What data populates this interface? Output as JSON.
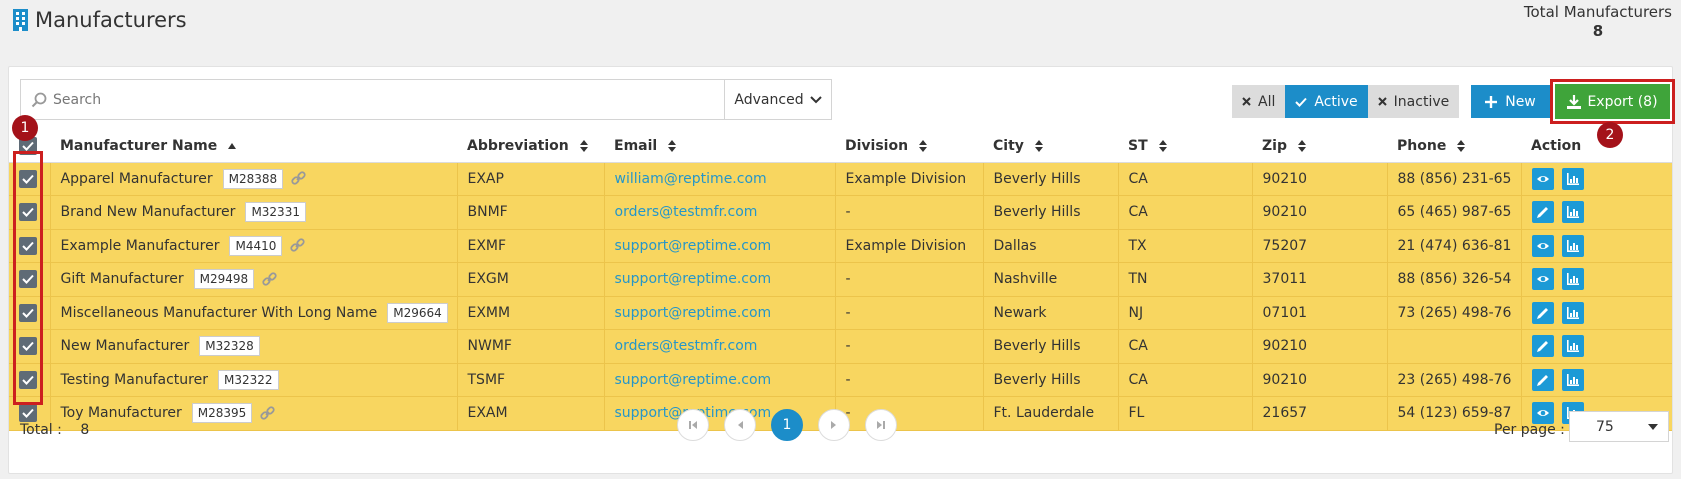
{
  "header": {
    "title": "Manufacturers",
    "total_label": "Total Manufacturers",
    "total_value": "8"
  },
  "toolbar": {
    "search_placeholder": "Search",
    "advanced_label": "Advanced",
    "filter_all": "All",
    "filter_active": "Active",
    "filter_inactive": "Inactive",
    "active_filter": "Active",
    "new_label": "New",
    "export_label": "Export (8)"
  },
  "annotations": {
    "marker1": "1",
    "marker2": "2"
  },
  "table": {
    "columns": {
      "name": "Manufacturer Name",
      "abbr": "Abbreviation",
      "email": "Email",
      "division": "Division",
      "city": "City",
      "st": "ST",
      "zip": "Zip",
      "phone": "Phone",
      "action": "Action"
    },
    "rows": [
      {
        "name": "Apparel Manufacturer",
        "code": "M28388",
        "link": true,
        "abbr": "EXAP",
        "email": "william@reptime.com",
        "division": "Example Division",
        "city": "Beverly Hills",
        "st": "CA",
        "zip": "90210",
        "phone": "88 (856) 231-65",
        "action": "view"
      },
      {
        "name": "Brand New Manufacturer",
        "code": "M32331",
        "link": false,
        "abbr": "BNMF",
        "email": "orders@testmfr.com",
        "division": "-",
        "city": "Beverly Hills",
        "st": "CA",
        "zip": "90210",
        "phone": "65 (465) 987-65",
        "action": "edit"
      },
      {
        "name": "Example Manufacturer",
        "code": "M4410",
        "link": true,
        "abbr": "EXMF",
        "email": "support@reptime.com",
        "division": "Example Division",
        "city": "Dallas",
        "st": "TX",
        "zip": "75207",
        "phone": "21 (474) 636-81",
        "action": "view"
      },
      {
        "name": "Gift Manufacturer",
        "code": "M29498",
        "link": true,
        "abbr": "EXGM",
        "email": "support@reptime.com",
        "division": "-",
        "city": "Nashville",
        "st": "TN",
        "zip": "37011",
        "phone": "88 (856) 326-54",
        "action": "view"
      },
      {
        "name": "Miscellaneous Manufacturer With Long Name",
        "code": "M29664",
        "link": false,
        "abbr": "EXMM",
        "email": "support@reptime.com",
        "division": "-",
        "city": "Newark",
        "st": "NJ",
        "zip": "07101",
        "phone": "73 (265) 498-76",
        "action": "edit"
      },
      {
        "name": "New Manufacturer",
        "code": "M32328",
        "link": false,
        "abbr": "NWMF",
        "email": "orders@testmfr.com",
        "division": "-",
        "city": "Beverly Hills",
        "st": "CA",
        "zip": "90210",
        "phone": "",
        "action": "edit"
      },
      {
        "name": "Testing Manufacturer",
        "code": "M32322",
        "link": false,
        "abbr": "TSMF",
        "email": "support@reptime.com",
        "division": "-",
        "city": "Beverly Hills",
        "st": "CA",
        "zip": "90210",
        "phone": "23 (265) 498-76",
        "action": "edit"
      },
      {
        "name": "Toy Manufacturer",
        "code": "M28395",
        "link": true,
        "abbr": "EXAM",
        "email": "support@reptime.com",
        "division": "-",
        "city": "Ft. Lauderdale",
        "st": "FL",
        "zip": "21657",
        "phone": "54 (123) 659-87",
        "action": "view"
      }
    ]
  },
  "footer": {
    "total_label": "Total :",
    "total_value": "8",
    "current_page": "1",
    "per_page_label": "Per page :",
    "per_page_value": "75"
  },
  "colors": {
    "row_highlight": "#f8d660",
    "accent_blue": "#1c8dc9",
    "export_green": "#3fa43a",
    "annotation_red": "#cc1f1f",
    "marker_red": "#a4121a"
  }
}
